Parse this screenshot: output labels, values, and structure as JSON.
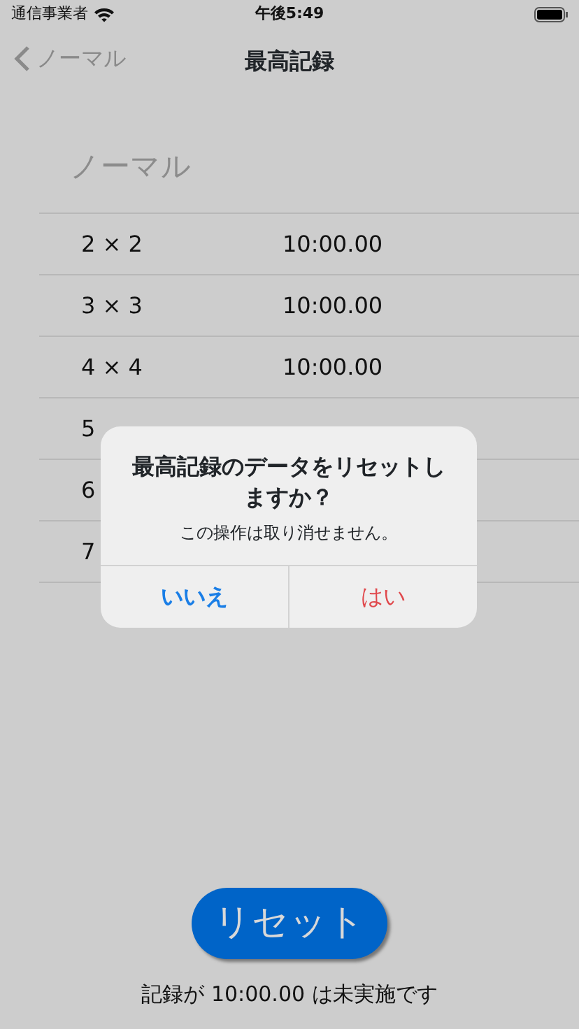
{
  "status_bar": {
    "carrier": "通信事業者",
    "time": "午後5:49"
  },
  "nav_bar": {
    "back_label": "ノーマル",
    "title": "最高記録"
  },
  "section": {
    "header": "ノーマル"
  },
  "rows": [
    {
      "label": "2 × 2",
      "time": "10:00.00"
    },
    {
      "label": "3 × 3",
      "time": "10:00.00"
    },
    {
      "label": "4 × 4",
      "time": "10:00.00"
    },
    {
      "label": "5"
    },
    {
      "label": "6"
    },
    {
      "label": "7"
    }
  ],
  "alert": {
    "title": "最高記録のデータをリセットしますか？",
    "message": "この操作は取り消せません。",
    "actions": [
      {
        "label": "いいえ",
        "kind": "cancel"
      },
      {
        "label": "はい",
        "kind": "destructive"
      }
    ]
  },
  "reset_button": "リセット",
  "footer": "記録が 10:00.00 は未実施です"
}
